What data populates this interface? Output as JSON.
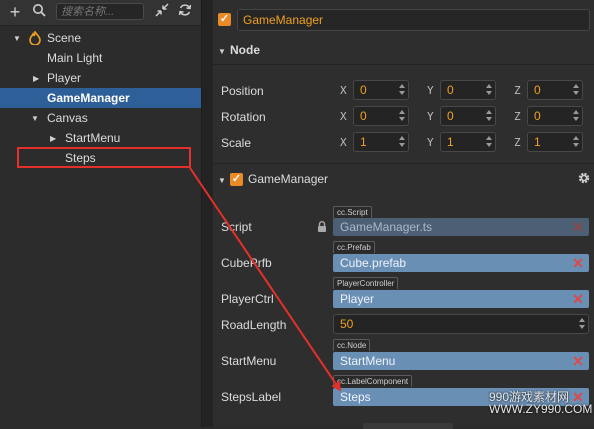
{
  "hierarchy": {
    "search_placeholder": "搜索名称...",
    "items": [
      {
        "label": "Scene"
      },
      {
        "label": "Main Light"
      },
      {
        "label": "Player"
      },
      {
        "label": "GameManager"
      },
      {
        "label": "Canvas"
      },
      {
        "label": "StartMenu"
      },
      {
        "label": "Steps"
      }
    ]
  },
  "inspector": {
    "node_name": "GameManager",
    "node_section": "Node",
    "transform": {
      "position": {
        "label": "Position",
        "x": "0",
        "y": "0",
        "z": "0"
      },
      "rotation": {
        "label": "Rotation",
        "x": "0",
        "y": "0",
        "z": "0"
      },
      "scale": {
        "label": "Scale",
        "x": "1",
        "y": "1",
        "z": "1"
      },
      "axis_x": "X",
      "axis_y": "Y",
      "axis_z": "Z"
    },
    "component": {
      "title": "GameManager",
      "props": [
        {
          "label": "Script",
          "type_tag": "cc.Script",
          "value": "GameManager.ts"
        },
        {
          "label": "CubePrfb",
          "type_tag": "cc.Prefab",
          "value": "Cube.prefab"
        },
        {
          "label": "PlayerCtrl",
          "type_tag": "PlayerController",
          "value": "Player"
        },
        {
          "label": "RoadLength",
          "value": "50"
        },
        {
          "label": "StartMenu",
          "type_tag": "cc.Node",
          "value": "StartMenu"
        },
        {
          "label": "StepsLabel",
          "type_tag": "cc.LabelComponent",
          "value": "Steps"
        }
      ]
    }
  },
  "watermark": {
    "line1": "990游戏素材网",
    "line2": "WWW.ZY990.COM"
  },
  "colors": {
    "accent": "#e98b27",
    "selection": "#2f5f99",
    "highlight": "#e3302a",
    "ref_field": "#6a8fb5"
  }
}
